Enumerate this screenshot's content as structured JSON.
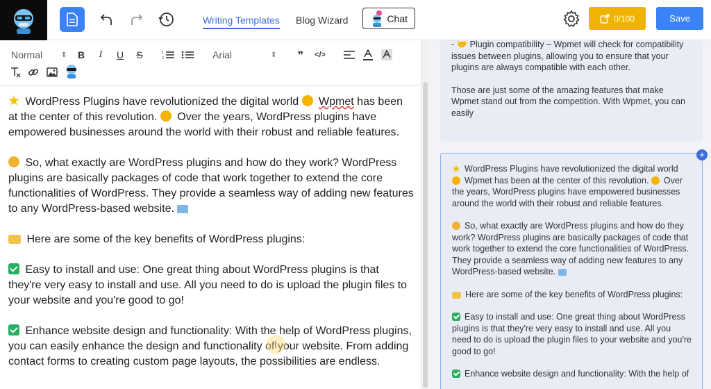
{
  "header": {
    "nav": {
      "writing_templates": "Writing Templates",
      "blog_wizard": "Blog Wizard",
      "chat": "Chat"
    },
    "credits": "0/100",
    "save": "Save"
  },
  "toolbar": {
    "heading_select": "Normal",
    "font_select": "Arial",
    "bold": "B",
    "italic": "I",
    "underline": "U",
    "strike": "S",
    "quote": "❞",
    "code": "</>"
  },
  "editor": {
    "paragraphs": [
      "WordPress Plugins have revolutionized the digital world",
      "Wpmet",
      "has been at the center of this revolution.",
      "Over the years, WordPress plugins have empowered businesses around the world with their robust and reliable features.",
      "So, what exactly are WordPress plugins and how do they work? WordPress plugins are basically packages of code that work together to extend the core functionalities of WordPress. They provide a seamless way of adding new features to any WordPress-based website.",
      "Here are some of the key benefits of WordPress plugins:",
      "Easy to install and use: One great thing about WordPress plugins is that they're very easy to install and use. All you need to do is upload the plugin files to your website and you're good to go!",
      "Enhance website design and functionality: With the help of WordPress plugins, you can easily enhance the design and functionality of your website. From adding contact forms to creating custom page layouts, the possibilities are endless."
    ]
  },
  "right_panel": {
    "top_card": [
      "- 🤝 Plugin compatibility – Wpmet will check for compatibility issues between plugins, allowing you to ensure that your plugins are always compatible with each other.",
      "Those are just some of the amazing features that make Wpmet stand out from the competition. With Wpmet, you can easily"
    ],
    "main_card": [
      "WordPress Plugins have revolutionized the digital world",
      "Wpmet has been at the center of this revolution.",
      "Over the years, WordPress plugins have empowered businesses around the world with their robust and reliable features.",
      "So, what exactly are WordPress plugins and how do they work? WordPress plugins are basically packages of code that work together to extend the core functionalities of WordPress. They provide a seamless way of adding new features to any WordPress-based website.",
      "Here are some of the key benefits of WordPress plugins:",
      "Easy to install and use: One great thing about WordPress plugins is that they're very easy to install and use. All you need to do is upload the plugin files to your website and you're good to go!",
      "Enhance website design and functionality: With the help of"
    ]
  },
  "icons": [
    "robot-logo-icon",
    "document-icon",
    "undo-icon",
    "redo-icon",
    "history-icon",
    "gear-icon",
    "share-icon",
    "plus-icon",
    "text-cursor-icon"
  ],
  "colors": {
    "primary": "#3b82f6",
    "credits": "#f0b400",
    "active_link": "#3b6fd8"
  }
}
